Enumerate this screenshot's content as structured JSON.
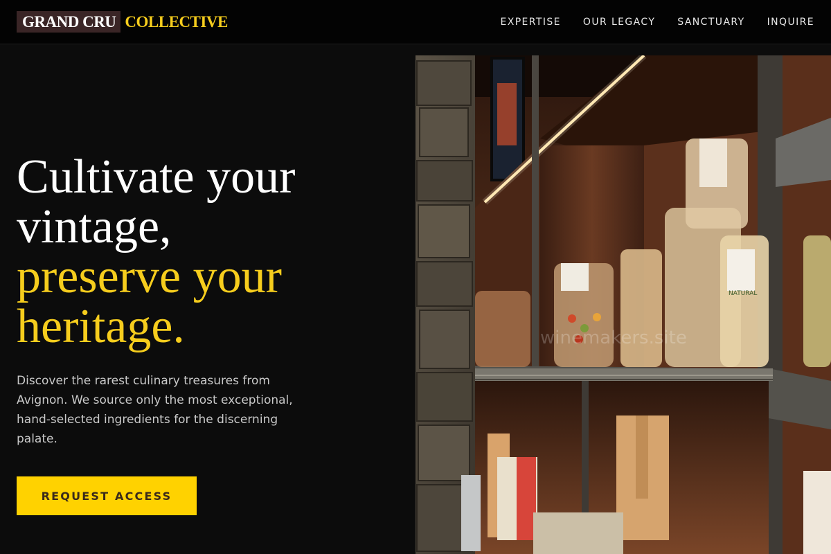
{
  "header": {
    "logo_part1": "GRAND CRU",
    "logo_part2": "COLLECTIVE",
    "nav": [
      "EXPERTISE",
      "OUR LEGACY",
      "SANCTUARY",
      "INQUIRE"
    ]
  },
  "hero": {
    "title_white": [
      "Cultivate your",
      "vintage,"
    ],
    "title_gold": [
      "preserve your",
      "heritage."
    ],
    "description": "Discover the rarest culinary treasures from Avignon. We source only the most exceptional, hand-selected ingredients for the discerning palate.",
    "cta_label": "REQUEST ACCESS"
  },
  "photo": {
    "watermark": "winemakers.site",
    "package_labels": [
      "NATURAL"
    ]
  },
  "colors": {
    "accent_gold": "#f6cd1d",
    "cta_yellow": "#ffd200",
    "logo_bg": "#3a2526",
    "page_bg": "#0c0c0c"
  }
}
